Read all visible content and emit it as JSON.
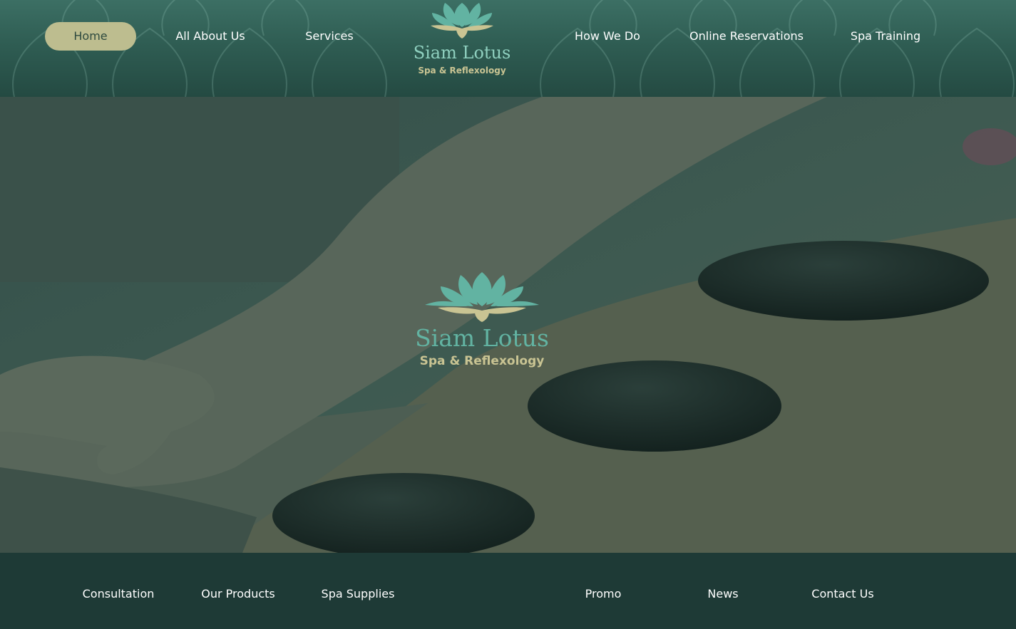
{
  "nav": {
    "items": [
      {
        "label": "Home",
        "active": true
      },
      {
        "label": "All About Us",
        "active": false
      },
      {
        "label": "Services",
        "active": false
      },
      {
        "label": "How We Do",
        "active": false
      },
      {
        "label": "Online Reservations",
        "active": false
      },
      {
        "label": "Spa Training",
        "active": false
      }
    ]
  },
  "brand": {
    "name": "Siam Lotus",
    "tagline": "Spa & Reflexology",
    "colors": {
      "teal": "#62b3a2",
      "sand": "#c9c493",
      "dark": "#1e3a36",
      "header": "#2f5d53"
    }
  },
  "hero": {
    "image": "hot-stone-massage-photo",
    "logo_name": "Siam Lotus",
    "logo_tagline": "Spa & Reflexology"
  },
  "footer": {
    "items": [
      {
        "label": "Consultation"
      },
      {
        "label": "Our Products"
      },
      {
        "label": "Spa Supplies"
      },
      {
        "label": "Promo"
      },
      {
        "label": "News"
      },
      {
        "label": "Contact Us"
      }
    ]
  }
}
